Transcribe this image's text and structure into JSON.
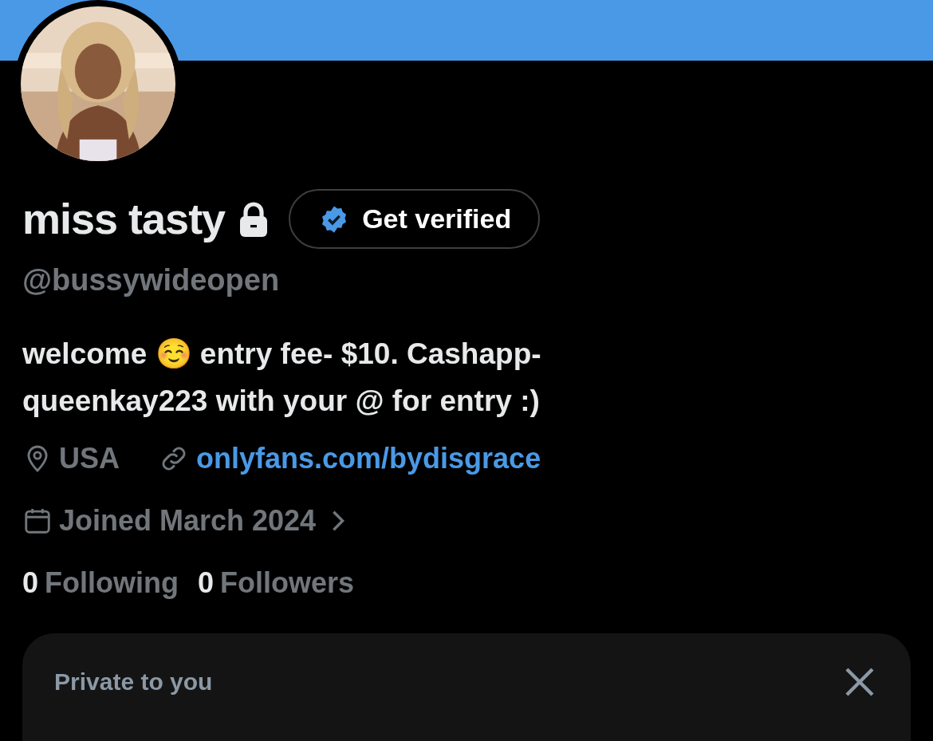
{
  "profile": {
    "name": "miss tasty",
    "protected": true,
    "verify_button": "Get verified",
    "handle": "@bussywideopen",
    "bio": "welcome ☺️ entry fee- $10. Cashapp-queenkay223 with your @ for entry :)",
    "location": "USA",
    "link": "onlyfans.com/bydisgrace",
    "joined": "Joined March 2024"
  },
  "stats": [
    {
      "count": "0",
      "label": "Following"
    },
    {
      "count": "0",
      "label": "Followers"
    }
  ],
  "private_card": {
    "title": "Private to you"
  }
}
